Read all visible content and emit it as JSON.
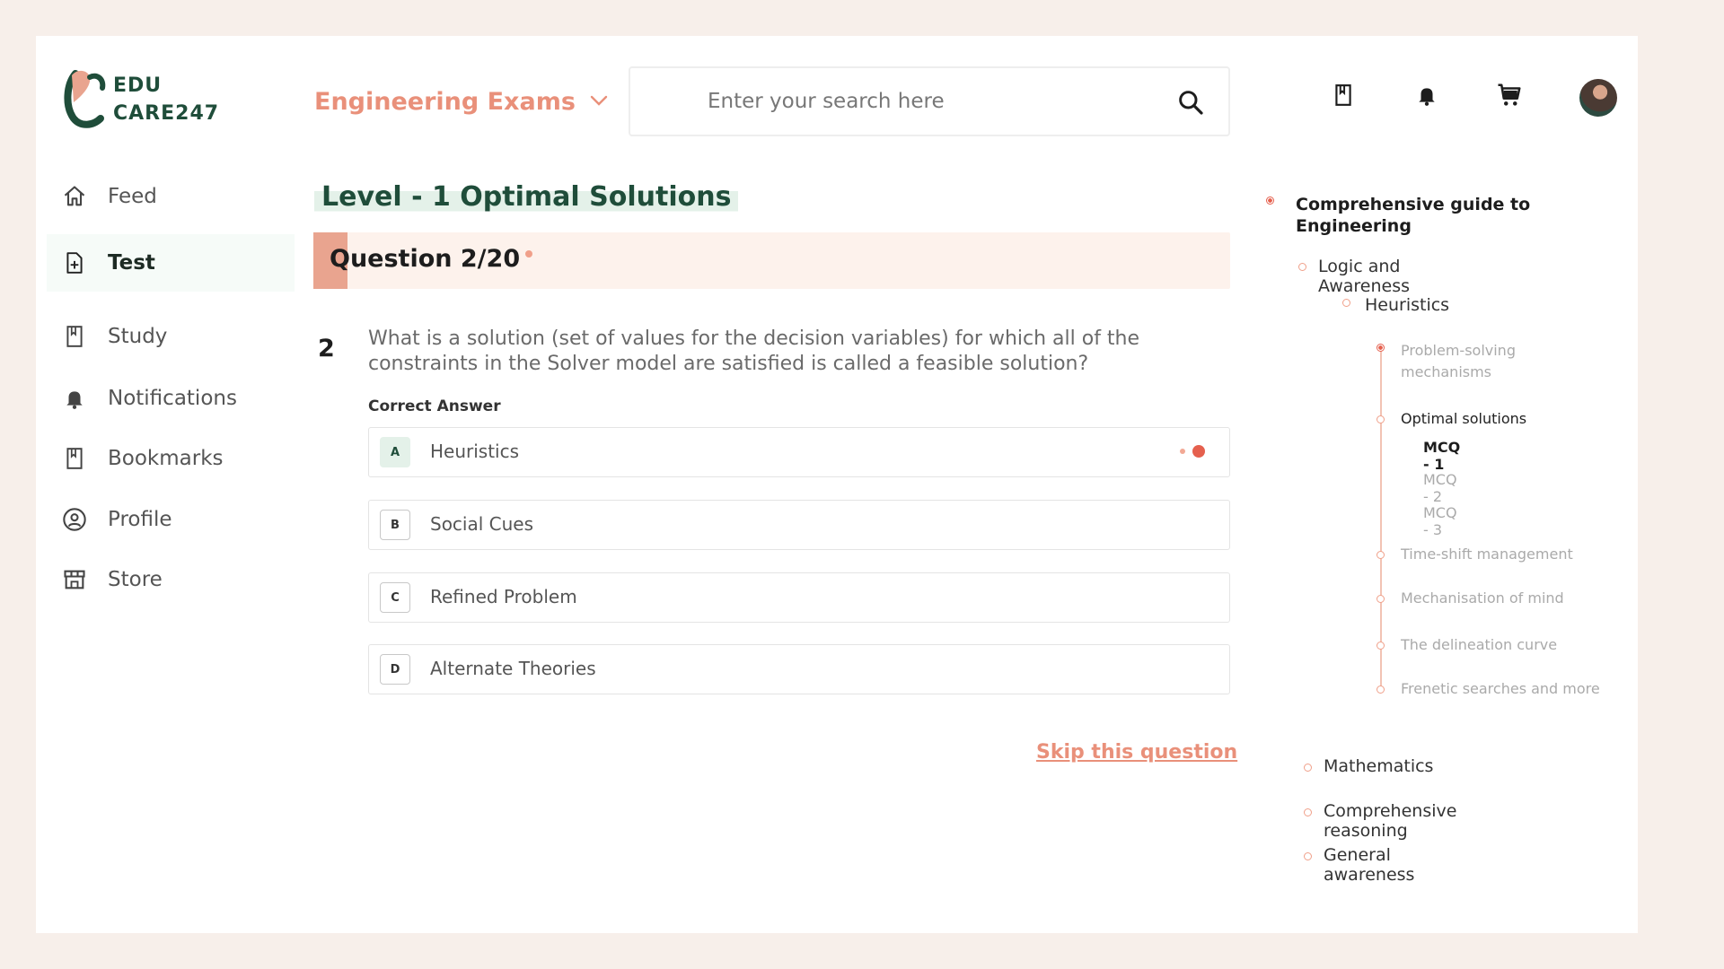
{
  "brand": {
    "line1": "EDU",
    "line2": "CARE247"
  },
  "colors": {
    "accent": "#e9907a",
    "brand_green": "#1f4d3a",
    "highlight": "#e4f1e9",
    "bg": "#f7efea"
  },
  "sidebar": {
    "items": [
      {
        "label": "Feed",
        "icon": "home-icon"
      },
      {
        "label": "Test",
        "icon": "test-doc-icon",
        "active": true
      },
      {
        "label": "Study",
        "icon": "study-book-icon"
      },
      {
        "label": "Notifications",
        "icon": "bell-icon"
      },
      {
        "label": "Bookmarks",
        "icon": "bookmark-icon"
      },
      {
        "label": "Profile",
        "icon": "profile-icon"
      },
      {
        "label": "Store",
        "icon": "store-icon"
      }
    ]
  },
  "header": {
    "exam_selector": "Engineering Exams",
    "search_placeholder": "Enter your search here"
  },
  "main": {
    "level_title": "Level - 1 Optimal Solutions",
    "question_counter": "Question 2/20",
    "question_number": "2",
    "question_text": "What is a solution (set of values for the decision variables) for which all of the constraints in the Solver model are satisfied is called a feasible solution?",
    "correct_answer_label": "Correct Answer",
    "options": [
      {
        "letter": "A",
        "text": "Heuristics",
        "correct": true
      },
      {
        "letter": "B",
        "text": "Social Cues"
      },
      {
        "letter": "C",
        "text": "Refined Problem"
      },
      {
        "letter": "D",
        "text": "Alternate Theories"
      }
    ],
    "skip_label": "Skip this question"
  },
  "tree": {
    "root": "Comprehensive guide to Engineering",
    "level1": "Logic and Awareness",
    "level2": "Heuristics",
    "topics": [
      "Problem-solving mechanisms",
      "Optimal solutions",
      "Time-shift management",
      "Mechanisation of mind",
      "The delineation curve",
      "Frenetic searches and more"
    ],
    "mcqs": [
      "MCQ - 1",
      "MCQ - 2",
      "MCQ - 3"
    ],
    "other_sections": [
      "Mathematics",
      "Comprehensive reasoning",
      "General awareness"
    ]
  }
}
